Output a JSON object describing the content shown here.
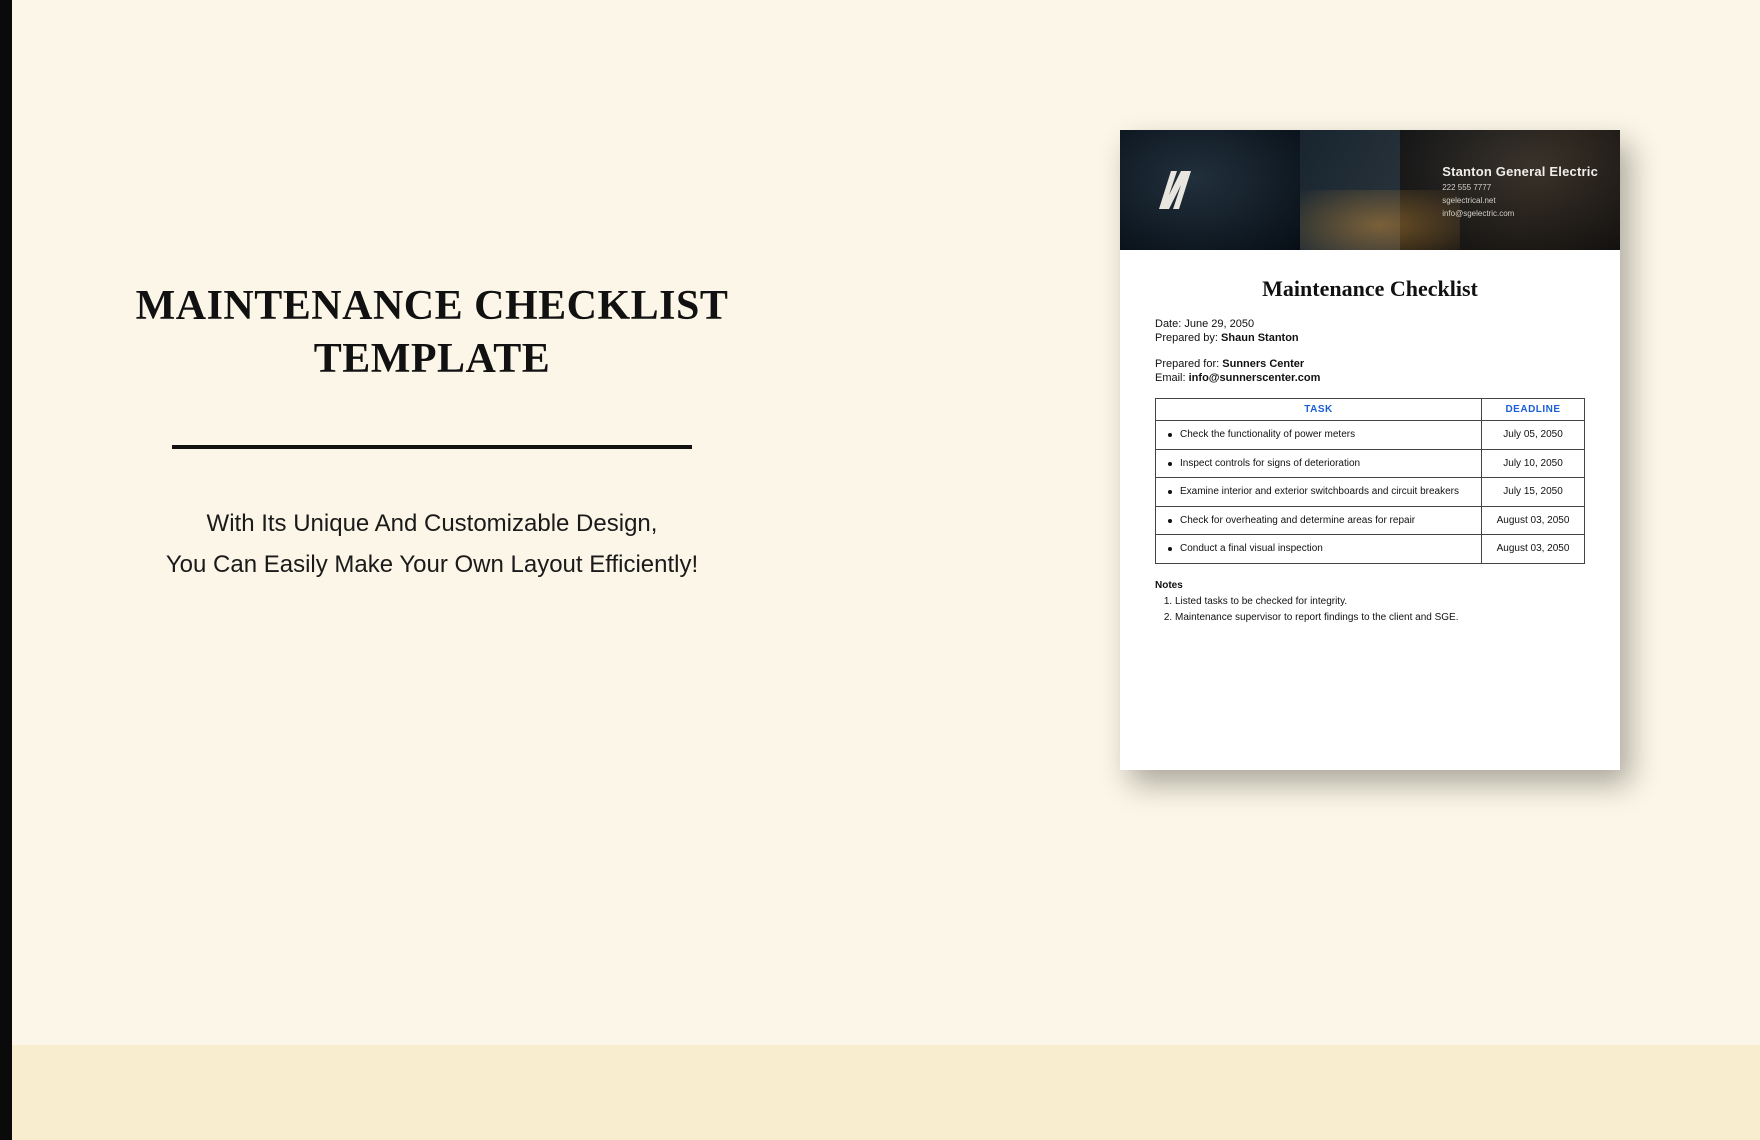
{
  "promo": {
    "title_line1": "MAINTENANCE CHECKLIST",
    "title_line2": "TEMPLATE",
    "subtitle_line1": "With Its Unique And Customizable Design,",
    "subtitle_line2": "You Can Easily Make Your Own Layout Efficiently!"
  },
  "document": {
    "header": {
      "company": "Stanton General Electric",
      "phone": "222 555 7777",
      "website": "sgelectrical.net",
      "email": "info@sgelectric.com"
    },
    "title": "Maintenance Checklist",
    "meta": {
      "date_label": "Date: ",
      "date_value": "June 29, 2050",
      "prepared_by_label": "Prepared by: ",
      "prepared_by_value": "Shaun Stanton",
      "prepared_for_label": "Prepared for: ",
      "prepared_for_value": "Sunners Center",
      "email_label": "Email: ",
      "email_value": "info@sunnerscenter.com"
    },
    "table": {
      "head_task": "TASK",
      "head_deadline": "DEADLINE",
      "rows": [
        {
          "task": "Check the functionality of power meters",
          "deadline": "July 05, 2050"
        },
        {
          "task": "Inspect controls for signs of deterioration",
          "deadline": "July 10, 2050"
        },
        {
          "task": "Examine interior and exterior switchboards and circuit breakers",
          "deadline": "July 15, 2050"
        },
        {
          "task": "Check for overheating and determine areas for repair",
          "deadline": "August 03, 2050"
        },
        {
          "task": "Conduct a final visual inspection",
          "deadline": "August 03, 2050"
        }
      ]
    },
    "notes": {
      "title": "Notes",
      "items": [
        "Listed tasks to be checked for integrity.",
        "Maintenance supervisor to report findings to the client and SGE."
      ]
    }
  }
}
